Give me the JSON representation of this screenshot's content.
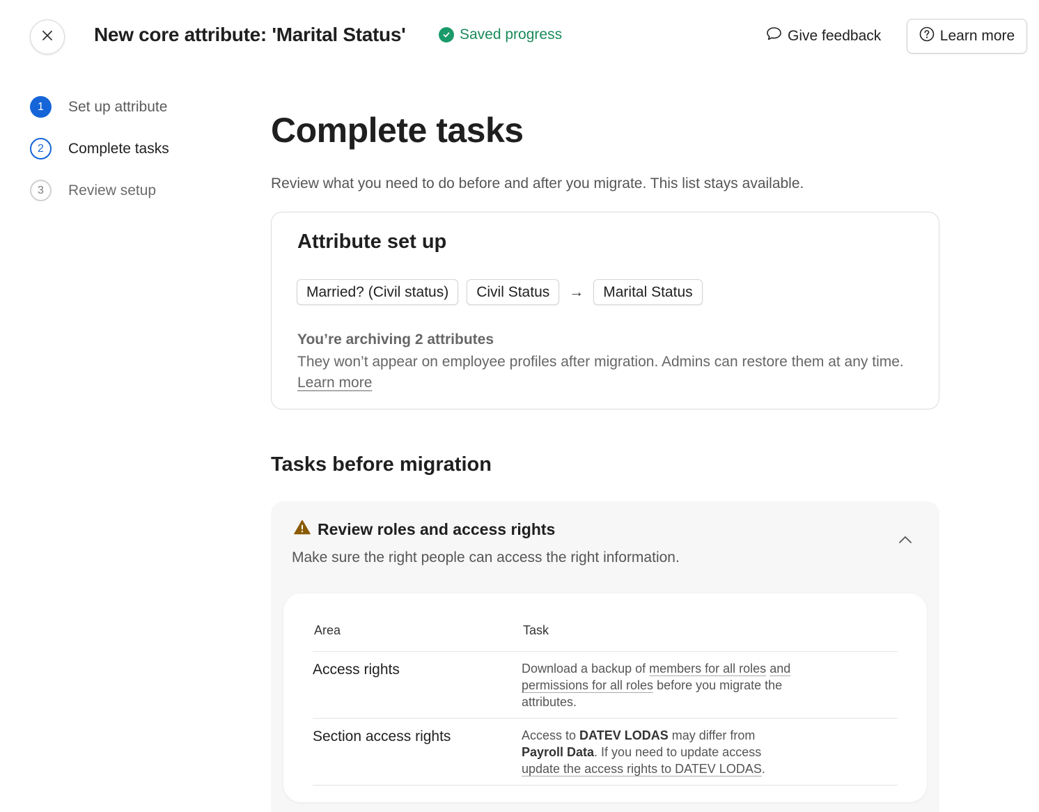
{
  "header": {
    "title": "New core attribute: 'Marital Status'",
    "saved_status": "Saved progress",
    "feedback_label": "Give feedback",
    "learn_more_label": "Learn more",
    "accent_color": "#1565d8",
    "success_color": "#1a8a5a"
  },
  "steps": [
    {
      "number": "1",
      "label": "Set up attribute",
      "state": "done"
    },
    {
      "number": "2",
      "label": "Complete tasks",
      "state": "current"
    },
    {
      "number": "3",
      "label": "Review setup",
      "state": "upcoming"
    }
  ],
  "main": {
    "title": "Complete tasks",
    "subtitle": "Review what you need to do before and after you migrate. This list stays available."
  },
  "attribute_card": {
    "title": "Attribute set up",
    "sources": [
      "Married? (Civil status)",
      "Civil Status"
    ],
    "arrow": "→",
    "target": "Marital Status",
    "archive_title": "You’re archiving 2 attributes",
    "archive_text": "They won’t appear on employee profiles after migration. Admins can restore them at any time.",
    "archive_link": "Learn more"
  },
  "tasks_before": {
    "section_title": "Tasks before migration",
    "group_title": "Review roles and access rights",
    "group_desc": "Make sure the right people can access the right information.",
    "warning_color": "#8a5a00",
    "columns": [
      "Area",
      "Task"
    ],
    "rows": [
      {
        "area": "Access rights",
        "task_parts": {
          "t1": "Download a backup of ",
          "l1": "members for all roles",
          "t2": " ",
          "l2": "and permissions for all roles",
          "t3": " before you migrate the attributes."
        }
      },
      {
        "area": "Section access rights",
        "task_parts": {
          "t1": "Access to ",
          "b1": "DATEV LODAS",
          "t2": " may differ from ",
          "b2": "Payroll Data",
          "t3": ". If you need to update access ",
          "l1": "update the access rights to DATEV LODAS",
          "t4": "."
        }
      }
    ]
  }
}
